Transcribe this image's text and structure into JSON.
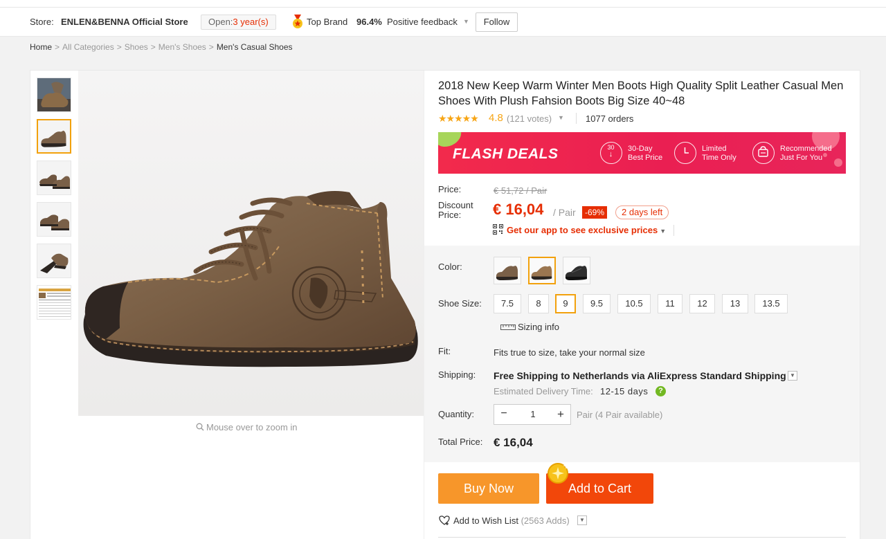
{
  "store": {
    "label": "Store:",
    "name": "ENLEN&BENNA Official Store",
    "open_prefix": "Open:",
    "open_years": "3 year(s)",
    "top_brand": "Top Brand",
    "feedback_pct": "96.4%",
    "feedback_label": "Positive feedback",
    "follow": "Follow"
  },
  "breadcrumb": {
    "home": "Home",
    "items": [
      "All Categories",
      "Shoes",
      "Men's Shoes"
    ],
    "current": "Men's Casual Shoes",
    "separator": ">"
  },
  "gallery": {
    "thumb_count": 6,
    "selected_thumb": 2,
    "zoom_hint": "Mouse over to zoom in"
  },
  "product": {
    "title": "2018 New Keep Warm Winter Men Boots High Quality Split Leather Casual Men Shoes With Plush Fahsion Boots Big Size 40~48",
    "rating": "4.8",
    "rating_stars": 5,
    "votes": "(121 votes)",
    "orders": "1077 orders"
  },
  "flash": {
    "title": "FLASH DEALS",
    "feature1_line1": "30-Day",
    "feature1_line2": "Best Price",
    "feature1_icon_text": "30",
    "feature2_line1": "Limited",
    "feature2_line2": "Time Only",
    "feature3_line1": "Recommended",
    "feature3_line2": "Just For You"
  },
  "price": {
    "price_label": "Price:",
    "original": "€ 51,72 / Pair",
    "discount_label": "Discount Price:",
    "discount": "€ 16,04",
    "per_pair": "/ Pair",
    "off": "-69%",
    "days_left": "2 days left",
    "app_promo": "Get our app to see exclusive prices"
  },
  "sku": {
    "color_label": "Color:",
    "colors": [
      "khaki-boot",
      "light-brown-boot",
      "black-boot"
    ],
    "selected_color": 1,
    "size_label": "Shoe Size:",
    "sizes": [
      "7.5",
      "8",
      "9",
      "9.5",
      "10.5",
      "11",
      "12",
      "13",
      "13.5"
    ],
    "selected_size": "9",
    "sizing_info": "Sizing info",
    "fit_label": "Fit:",
    "fit_value": "Fits true to size, take your normal size",
    "shipping_label": "Shipping:",
    "shipping_value": "Free Shipping to Netherlands via AliExpress Standard Shipping",
    "eta_label": "Estimated Delivery Time:",
    "eta_value": "12-15 days",
    "quantity_label": "Quantity:",
    "quantity": "1",
    "minus": "−",
    "plus": "+",
    "available": "Pair (4 Pair available)",
    "total_label": "Total Price:",
    "total": "€ 16,04"
  },
  "actions": {
    "buy_now": "Buy Now",
    "add_to_cart": "Add to Cart",
    "wish_list": "Add to Wish List",
    "wish_count": "(2563 Adds)"
  },
  "colors": {
    "accent_red": "#e62e04",
    "buy_orange": "#f7962a",
    "cart_orange": "#f2470a",
    "star_yellow": "#f7a515",
    "selected_border": "#f2a10c",
    "flash_pink": "#ea1f52"
  }
}
